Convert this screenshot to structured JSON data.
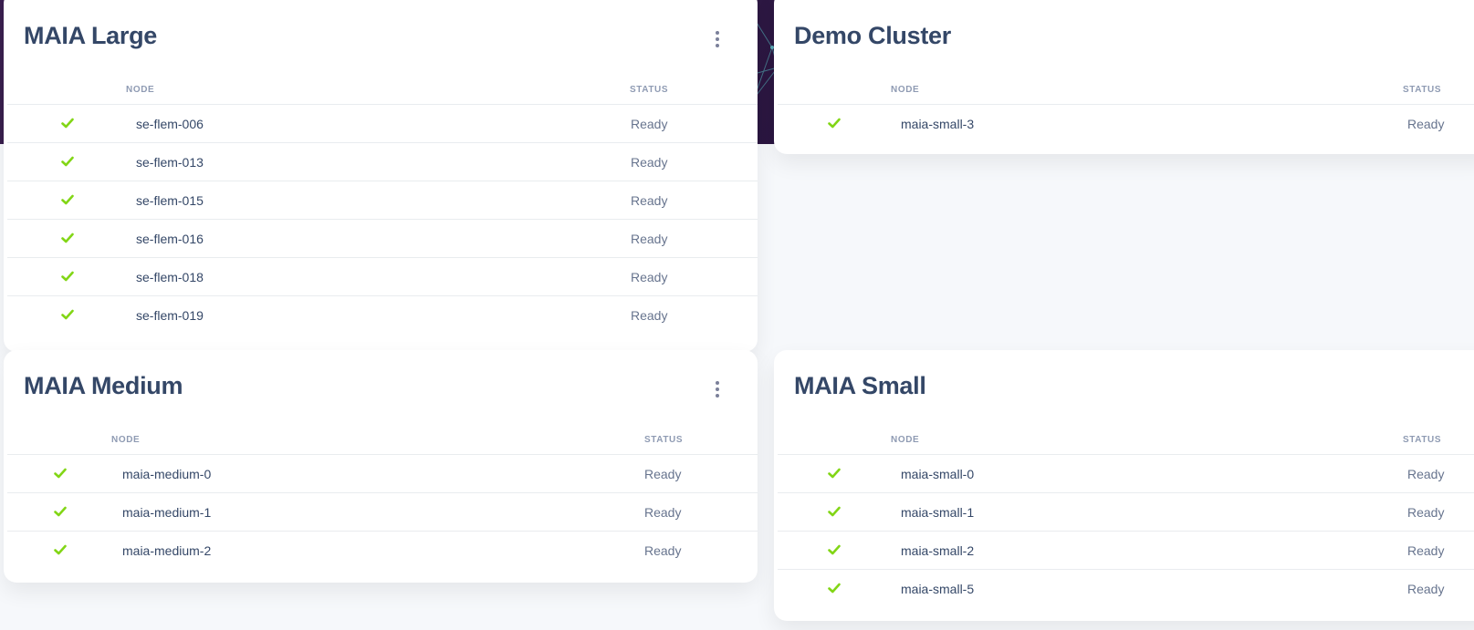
{
  "clusters": [
    {
      "title": "MAIA Large",
      "col_node": "NODE",
      "col_status": "STATUS",
      "nodes": [
        {
          "name": "se-flem-006",
          "status": "Ready"
        },
        {
          "name": "se-flem-013",
          "status": "Ready"
        },
        {
          "name": "se-flem-015",
          "status": "Ready"
        },
        {
          "name": "se-flem-016",
          "status": "Ready"
        },
        {
          "name": "se-flem-018",
          "status": "Ready"
        },
        {
          "name": "se-flem-019",
          "status": "Ready"
        }
      ]
    },
    {
      "title": "Demo Cluster",
      "col_node": "NODE",
      "col_status": "STATUS",
      "nodes": [
        {
          "name": "maia-small-3",
          "status": "Ready"
        }
      ]
    },
    {
      "title": "MAIA Medium",
      "col_node": "NODE",
      "col_status": "STATUS",
      "nodes": [
        {
          "name": "maia-medium-0",
          "status": "Ready"
        },
        {
          "name": "maia-medium-1",
          "status": "Ready"
        },
        {
          "name": "maia-medium-2",
          "status": "Ready"
        }
      ]
    },
    {
      "title": "MAIA Small",
      "col_node": "NODE",
      "col_status": "STATUS",
      "nodes": [
        {
          "name": "maia-small-0",
          "status": "Ready"
        },
        {
          "name": "maia-small-1",
          "status": "Ready"
        },
        {
          "name": "maia-small-2",
          "status": "Ready"
        },
        {
          "name": "maia-small-5",
          "status": "Ready"
        }
      ]
    }
  ],
  "icons": {
    "status_ok": "check-icon",
    "menu": "more-vertical-icon"
  },
  "colors": {
    "check": "#82d616",
    "title": "#344767",
    "header_bg": "#2a1640"
  }
}
